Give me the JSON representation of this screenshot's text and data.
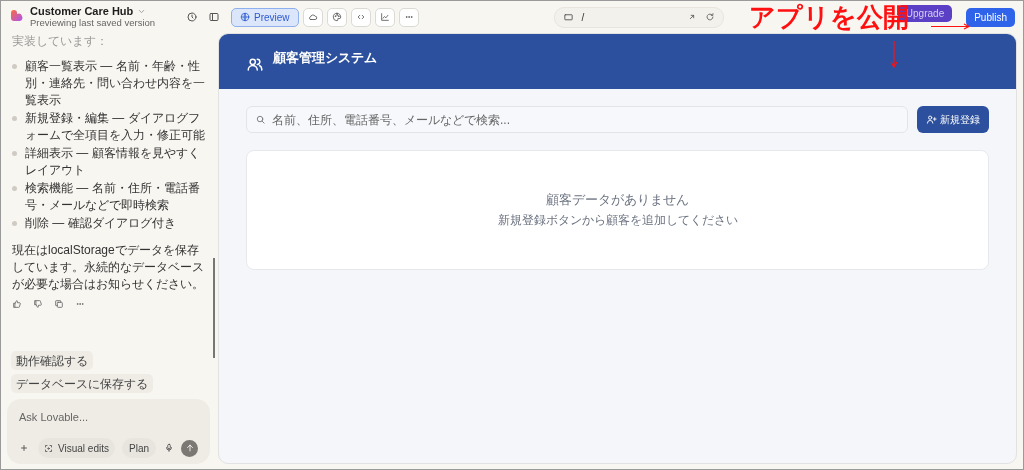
{
  "project": {
    "name": "Customer Care Hub",
    "subtitle": "Previewing last saved version"
  },
  "toolbar": {
    "tabs": [
      {
        "label": "Preview",
        "selected": true,
        "kind": "globe"
      },
      {
        "selected": false,
        "kind": "cloud"
      },
      {
        "selected": false,
        "kind": "palette"
      },
      {
        "selected": false,
        "kind": "code"
      },
      {
        "selected": false,
        "kind": "chart"
      },
      {
        "selected": false,
        "kind": "more"
      }
    ],
    "url": "/",
    "upgrade": "Upgrade",
    "publish": "Publish"
  },
  "chat": {
    "intro": "実装しています：",
    "bullets": [
      "顧客一覧表示 — 名前・年齢・性別・連絡先・問い合わせ内容を一覧表示",
      "新規登録・編集 — ダイアログフォームで全項目を入力・修正可能",
      "詳細表示 — 顧客情報を見やすくレイアウト",
      "検索機能 — 名前・住所・電話番号・メールなどで即時検索",
      "削除 — 確認ダイアログ付き"
    ],
    "note": "現在はlocalStorageでデータを保存しています。永続的なデータベースが必要な場合はお知らせください。",
    "suggestions": [
      "動作確認する",
      "データベースに保存する"
    ],
    "input": {
      "placeholder": "Ask Lovable..."
    },
    "visual_edits": "Visual edits",
    "plan": "Plan"
  },
  "app": {
    "title": "顧客管理システム",
    "search": {
      "placeholder": "名前、住所、電話番号、メールなどで検索..."
    },
    "new_button": "新規登録",
    "empty_title": "顧客データがありません",
    "empty_hint": "新規登録ボタンから顧客を追加してください"
  },
  "annotation": {
    "text": "アプリを公開"
  }
}
